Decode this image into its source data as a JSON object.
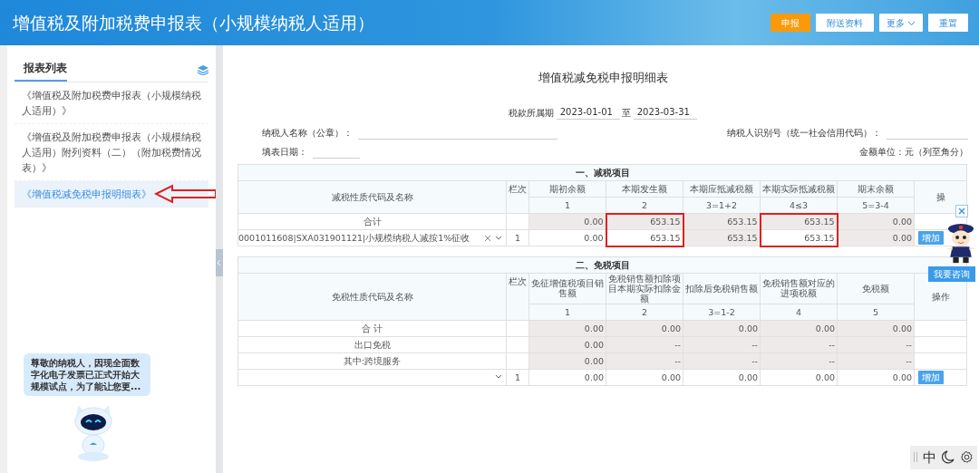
{
  "header": {
    "title": "增值税及附加税费申报表（小规模纳税人适用）",
    "buttons": [
      {
        "label": "申报",
        "kind": "primary"
      },
      {
        "label": "附送资料",
        "kind": "default"
      },
      {
        "label": "更多",
        "kind": "dropdown"
      },
      {
        "label": "重置",
        "kind": "default"
      }
    ]
  },
  "sidebar": {
    "title": "报表列表",
    "items": [
      {
        "label": "《增值税及附加税费申报表（小规模纳税人适用）》",
        "selected": false
      },
      {
        "label": "《增值税及附加税费申报表（小规模纳税人适用）附列资料（二）（附加税费情况表）》",
        "selected": false
      },
      {
        "label": "《增值税减免税申报明细表》",
        "selected": true
      }
    ],
    "assistant_message": "尊敬的纳税人，因现全面数字化电子发票已正式开始大规模试点，为了能让您更..."
  },
  "form": {
    "title": "增值税减免税申报明细表",
    "period_label": "税款所属期",
    "period_start": "2023-01-01",
    "period_to": "至",
    "period_end": "2023-03-31",
    "taxpayer_name_label": "纳税人名称（公章）：",
    "taxpayer_id_label": "纳税人识别号（统一社会信用代码）：",
    "fill_date_label": "填表日期：",
    "unit_label": "金额单位：元（列至角分）"
  },
  "reduction": {
    "section_title": "一、减税项目",
    "name_header": "减税性质代码及名称",
    "line_header": "栏次",
    "action_header": "操",
    "columns": [
      {
        "header": "期初余额",
        "number": "1",
        "highlighted": false
      },
      {
        "header": "本期发生额",
        "number": "2",
        "highlighted": true
      },
      {
        "header": "本期应抵减税额",
        "number": "3=1+2",
        "highlighted": false
      },
      {
        "header": "本期实际抵减税额",
        "number": "4≤3",
        "highlighted": true
      },
      {
        "header": "期末余额",
        "number": "5=3-4",
        "highlighted": false
      }
    ],
    "rows": [
      {
        "kind": "total",
        "name": "合计",
        "line": "",
        "cells": [
          {
            "text": "0.00",
            "readonly": true
          },
          {
            "text": "653.15",
            "readonly": true
          },
          {
            "text": "653.15",
            "readonly": true
          },
          {
            "text": "653.15",
            "readonly": true
          },
          {
            "text": "0.00",
            "readonly": true
          }
        ]
      },
      {
        "kind": "entry",
        "name": "0001011608|SXA031901121|小规模纳税人减按1%征收",
        "line": "1",
        "cells": [
          {
            "text": "0.00",
            "readonly": false
          },
          {
            "text": "653.15",
            "readonly": false
          },
          {
            "text": "653.15",
            "readonly": true
          },
          {
            "text": "653.15",
            "readonly": false
          },
          {
            "text": "0.00",
            "readonly": true
          }
        ],
        "action": "增加"
      }
    ]
  },
  "exemption": {
    "section_title": "二、免税项目",
    "name_header": "免税性质代码及名称",
    "line_header": "栏次",
    "action_header": "操作",
    "columns": [
      {
        "header": "免征增值税项目销售额",
        "number": "1"
      },
      {
        "header": "免税销售额扣除项目本期实际扣除金额",
        "number": "2"
      },
      {
        "header": "扣除后免税销售额",
        "number": "3=1-2"
      },
      {
        "header": "免税销售额对应的进项税额",
        "number": "4"
      },
      {
        "header": "免税额",
        "number": "5"
      }
    ],
    "rows": [
      {
        "kind": "total",
        "name": "合 计",
        "line": "",
        "cells": [
          {
            "text": "0.00",
            "readonly": true
          },
          {
            "text": "0.00",
            "readonly": true
          },
          {
            "text": "0.00",
            "readonly": true
          },
          {
            "text": "0.00",
            "readonly": true
          },
          {
            "text": "0.00",
            "readonly": true
          }
        ]
      },
      {
        "kind": "label",
        "name": "出口免税",
        "line": "",
        "cells": [
          {
            "text": "0.00",
            "readonly": true
          },
          {
            "text": "--",
            "readonly": true
          },
          {
            "text": "--",
            "readonly": true
          },
          {
            "text": "--",
            "readonly": true
          },
          {
            "text": "--",
            "readonly": true
          }
        ]
      },
      {
        "kind": "label",
        "name": "其中:跨境服务",
        "line": "",
        "cells": [
          {
            "text": "0.00",
            "readonly": true
          },
          {
            "text": "--",
            "readonly": true
          },
          {
            "text": "--",
            "readonly": true
          },
          {
            "text": "--",
            "readonly": true
          },
          {
            "text": "--",
            "readonly": true
          }
        ]
      },
      {
        "kind": "entry",
        "name": "",
        "line": "1",
        "cells": [
          {
            "text": "0.00",
            "readonly": false
          },
          {
            "text": "0.00",
            "readonly": false
          },
          {
            "text": "0.00",
            "readonly": false
          },
          {
            "text": "0.00",
            "readonly": false
          },
          {
            "text": "0.00",
            "readonly": false
          }
        ],
        "action": "增加"
      }
    ]
  },
  "helper": {
    "consult_button": "我要咨询"
  },
  "toolbar": {
    "language": "中"
  }
}
